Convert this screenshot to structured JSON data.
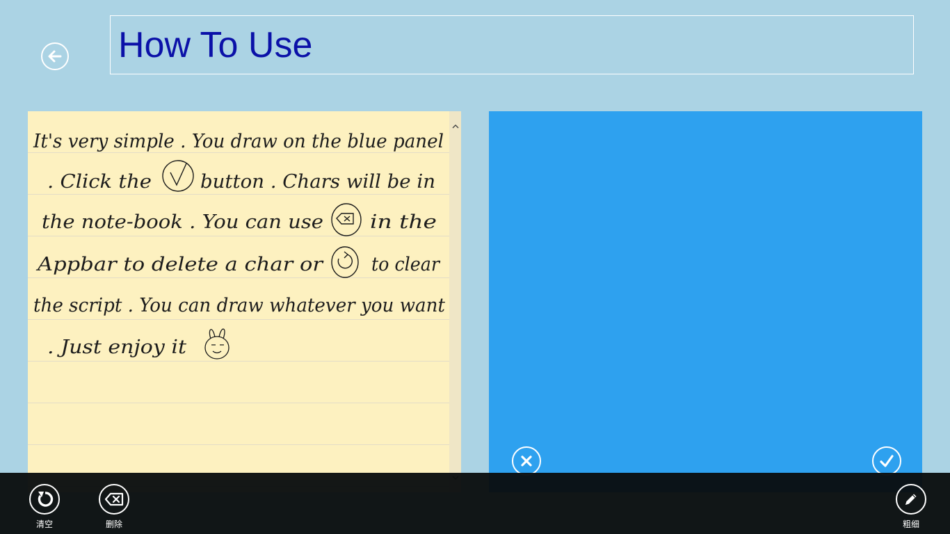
{
  "page": {
    "title": "How To Use"
  },
  "notebook": {
    "handwritten_lines": [
      "It's very simple . You draw on the blue panel",
      ". Click the ✓ button . Chars will be in",
      "the note-book . You can use ⌫ in the",
      "Appbar to delete a char or ↻ to clear",
      "the script . You can draw whatever you want",
      ". Just enjoy it ☺"
    ]
  },
  "draw_panel": {
    "background_color": "#2ea1ef",
    "cancel_icon": "close-icon",
    "confirm_icon": "checkmark-icon"
  },
  "appbar": {
    "buttons": [
      {
        "label": "清空",
        "icon": "refresh-icon"
      },
      {
        "label": "删除",
        "icon": "backspace-icon"
      },
      {
        "label": "粗细",
        "icon": "pencil-icon"
      }
    ]
  },
  "colors": {
    "page_background": "#abd3e4",
    "title_text": "#0b11a8",
    "notebook_paper": "#fdf1c0",
    "appbar_background": "#0a0e0f"
  }
}
